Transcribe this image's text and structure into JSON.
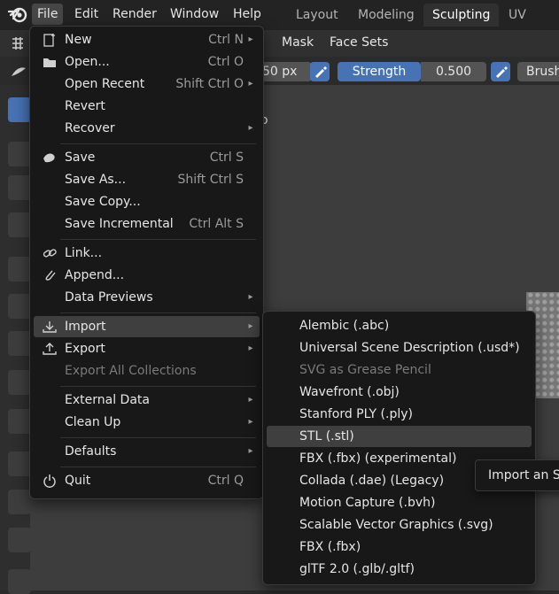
{
  "menubar": {
    "items": [
      "File",
      "Edit",
      "Render",
      "Window",
      "Help"
    ],
    "active": "File"
  },
  "workspaces": {
    "tabs": [
      "Layout",
      "Modeling",
      "Sculpting",
      "UV Editin"
    ],
    "active": "Sculpting"
  },
  "header": {
    "items": [
      "Mask",
      "Face Sets"
    ]
  },
  "tool_settings": {
    "radius_value": "50 px",
    "strength_label": "Strength",
    "strength_value": "0.500",
    "brush_label": "Brush",
    "viewport_fragment": "o"
  },
  "file_menu": {
    "items": [
      {
        "label": "New",
        "shortcut": "Ctrl N",
        "arrow": "▸",
        "icon": "new-file-icon"
      },
      {
        "label": "Open...",
        "shortcut": "Ctrl O",
        "icon": "folder-icon"
      },
      {
        "label": "Open Recent",
        "shortcut": "Shift Ctrl O",
        "arrow": "▸"
      },
      {
        "label": "Revert"
      },
      {
        "label": "Recover",
        "arrow": "▸"
      },
      {
        "label": "Save",
        "shortcut": "Ctrl S",
        "icon": "save-icon"
      },
      {
        "label": "Save As...",
        "shortcut": "Shift Ctrl S"
      },
      {
        "label": "Save Copy..."
      },
      {
        "label": "Save Incremental",
        "shortcut": "Ctrl Alt S"
      },
      {
        "label": "Link...",
        "icon": "link-icon"
      },
      {
        "label": "Append...",
        "icon": "append-icon"
      },
      {
        "label": "Data Previews",
        "arrow": "▸"
      },
      {
        "label": "Import",
        "arrow": "▸",
        "icon": "import-icon"
      },
      {
        "label": "Export",
        "arrow": "▸",
        "icon": "export-icon"
      },
      {
        "label": "Export All Collections"
      },
      {
        "label": "External Data",
        "arrow": "▸"
      },
      {
        "label": "Clean Up",
        "arrow": "▸"
      },
      {
        "label": "Defaults",
        "arrow": "▸"
      },
      {
        "label": "Quit",
        "shortcut": "Ctrl Q",
        "icon": "quit-icon"
      }
    ]
  },
  "import_menu": {
    "items": [
      "Alembic (.abc)",
      "Universal Scene Description (.usd*)",
      "SVG as Grease Pencil",
      "Wavefront (.obj)",
      "Stanford PLY (.ply)",
      "STL (.stl)",
      "FBX (.fbx) (experimental)",
      "Collada (.dae) (Legacy)",
      "Motion Capture (.bvh)",
      "Scalable Vector Graphics (.svg)",
      "FBX (.fbx)",
      "glTF 2.0 (.glb/.gltf)"
    ],
    "highlighted": "STL (.stl)"
  },
  "tooltip": {
    "text": "Import an ST"
  },
  "colors": {
    "accent": "#4772b3",
    "menu_bg": "#181818",
    "highlight": "#3f3f3f"
  }
}
